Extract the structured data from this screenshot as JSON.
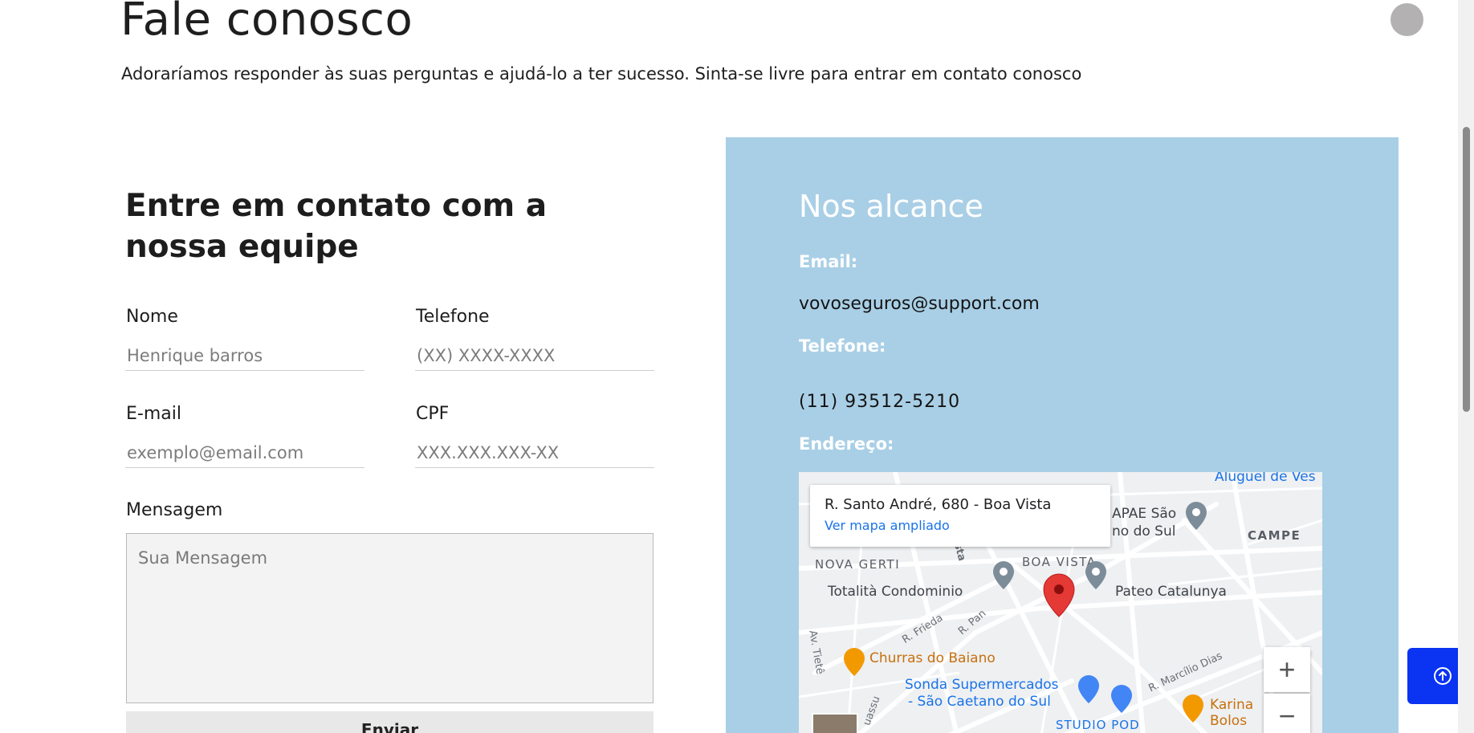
{
  "header": {
    "title": "Fale conosco",
    "subtitle": "Adoraríamos responder às suas perguntas e ajudá-lo a ter sucesso. Sinta-se livre para entrar em contato conosco"
  },
  "form": {
    "title": "Entre em contato com a nossa equipe",
    "nome": {
      "label": "Nome",
      "placeholder": "Henrique barros"
    },
    "telefone": {
      "label": "Telefone",
      "placeholder": "(XX) XXXX-XXXX"
    },
    "email": {
      "label": "E-mail",
      "placeholder": "exemplo@email.com"
    },
    "cpf": {
      "label": "CPF",
      "placeholder": "XXX.XXX.XXX-XX"
    },
    "mensagem": {
      "label": "Mensagem",
      "placeholder": "Sua Mensagem"
    },
    "submit_label": "Enviar"
  },
  "contact": {
    "title": "Nos alcance",
    "email_label": "Email:",
    "email_value": "vovoseguros@support.com",
    "phone_label": "Telefone:",
    "phone_value": "(11) 93512-5210",
    "address_label": "Endereço:",
    "panel_color": "#a9cfe6"
  },
  "map": {
    "address": "R. Santo André, 680 - Boa Vista",
    "link": "Ver mapa ampliado",
    "labels": {
      "aluguel": "Aluguel de Ves",
      "apae": "APAE São",
      "apae2": "no do Sul",
      "campe": "CAMPE",
      "nova_gerti": "NOVA GERTI",
      "boa_vista": "BOA VISTA",
      "totalita": "Totalità Condominio",
      "pateo": "Pateo Catalunya",
      "av_tiete": "Av. Tietê",
      "frieda": "R. Frieda",
      "pan": "R. Pan",
      "churras": "Churras do Baiano",
      "sonda": "Sonda Supermercados",
      "sonda2": "- São Caetano do Sul",
      "marcilio": "R. Marcílio Dias",
      "karina": "Karina",
      "karina2": "Bolos",
      "studio": "STUDIO POD",
      "assu": "uassu",
      "ista": "ista"
    },
    "zoom_in": "+",
    "zoom_out": "−",
    "pin_color": "#e53935"
  },
  "colors": {
    "scroll_button": "#0a33f2"
  },
  "icons": {
    "scroll_top": "arrow-up-circle-icon"
  }
}
